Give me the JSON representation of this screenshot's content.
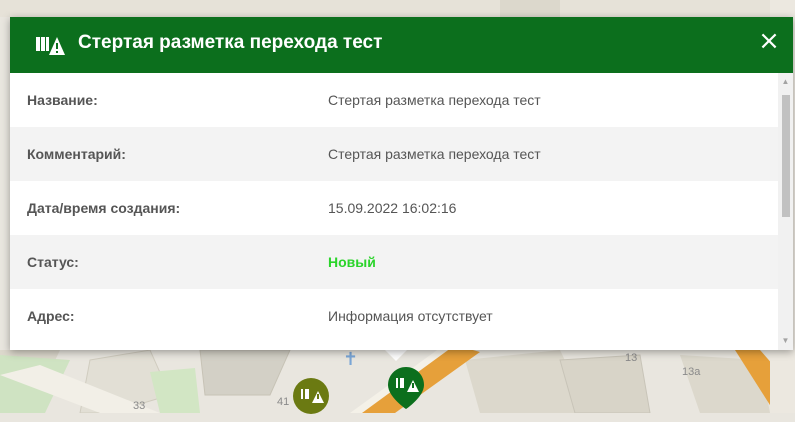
{
  "popup": {
    "title": "Стертая разметка перехода тест",
    "icon": "worn-marking-warning-icon",
    "close_label": "×",
    "header_color": "#0c6f1d",
    "rows": [
      {
        "label": "Название:",
        "value": "Стертая разметка перехода тест"
      },
      {
        "label": "Комментарий:",
        "value": "Стертая разметка перехода тест"
      },
      {
        "label": "Дата/время создания:",
        "value": "15.09.2022 16:02:16"
      },
      {
        "label": "Статус:",
        "value": "Новый"
      },
      {
        "label": "Адрес:",
        "value": "Информация отсутствует"
      }
    ],
    "status_color": "#2ad42a"
  },
  "map": {
    "labels": [
      "13",
      "13а",
      "33",
      "41"
    ],
    "markers": [
      {
        "type": "marking-warning-marker",
        "color": "#6b7a12"
      },
      {
        "type": "marking-warning-marker-selected",
        "color": "#0c6f1d"
      }
    ]
  }
}
